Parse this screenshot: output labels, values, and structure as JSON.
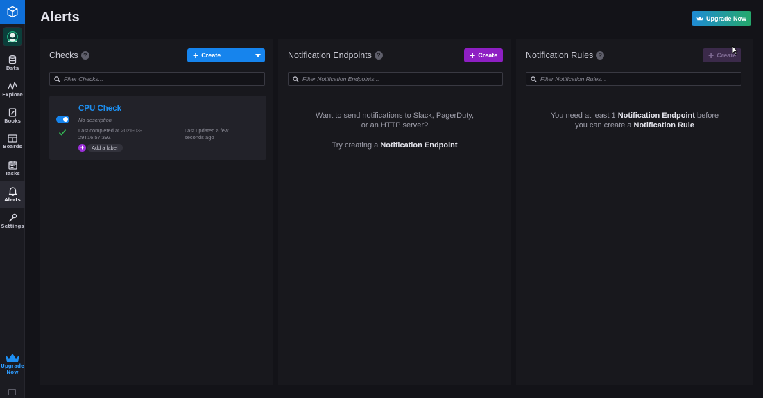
{
  "sidebar": {
    "items": [
      {
        "label": "Data",
        "icon": "database-icon"
      },
      {
        "label": "Explore",
        "icon": "explore-graph-icon"
      },
      {
        "label": "Books",
        "icon": "notebook-icon"
      },
      {
        "label": "Boards",
        "icon": "dashboard-icon"
      },
      {
        "label": "Tasks",
        "icon": "calendar-icon"
      },
      {
        "label": "Alerts",
        "icon": "bell-icon",
        "active": true
      },
      {
        "label": "Settings",
        "icon": "wrench-icon"
      }
    ],
    "upgrade_line1": "Upgrade",
    "upgrade_line2": "Now"
  },
  "header": {
    "title": "Alerts",
    "upgrade_button": "Upgrade Now"
  },
  "checks": {
    "title": "Checks",
    "create_label": "Create",
    "filter_placeholder": "Filter Checks...",
    "card": {
      "name": "CPU Check",
      "description": "No description",
      "last_completed_line1": "Last completed at 2021-03-",
      "last_completed_line2": "29T16:57:39Z",
      "last_updated_line1": "Last updated a few",
      "last_updated_line2": "seconds ago",
      "add_label": "Add a label",
      "enabled": true,
      "status": "ok"
    }
  },
  "endpoints": {
    "title": "Notification Endpoints",
    "create_label": "Create",
    "filter_placeholder": "Filter Notification Endpoints...",
    "empty_line1": "Want to send notifications to Slack, PagerDuty,",
    "empty_line2": "or an HTTP server?",
    "try_prefix": "Try creating a",
    "try_bold": "Notification Endpoint"
  },
  "rules": {
    "title": "Notification Rules",
    "create_label": "Create",
    "filter_placeholder": "Filter Notification Rules...",
    "empty_prefix": "You need at least 1",
    "empty_bold1": "Notification Endpoint",
    "empty_suffix": "before",
    "empty_line2_prefix": "you can create a",
    "empty_bold2": "Notification Rule"
  },
  "colors": {
    "brand_blue": "#0f6fd8",
    "create_checks": "#1684ed",
    "create_endpoints": "#8e1fc3",
    "create_rules_disabled": "#3b2a4a",
    "link_blue": "#1d8ff0",
    "ok_green": "#34bb55"
  }
}
